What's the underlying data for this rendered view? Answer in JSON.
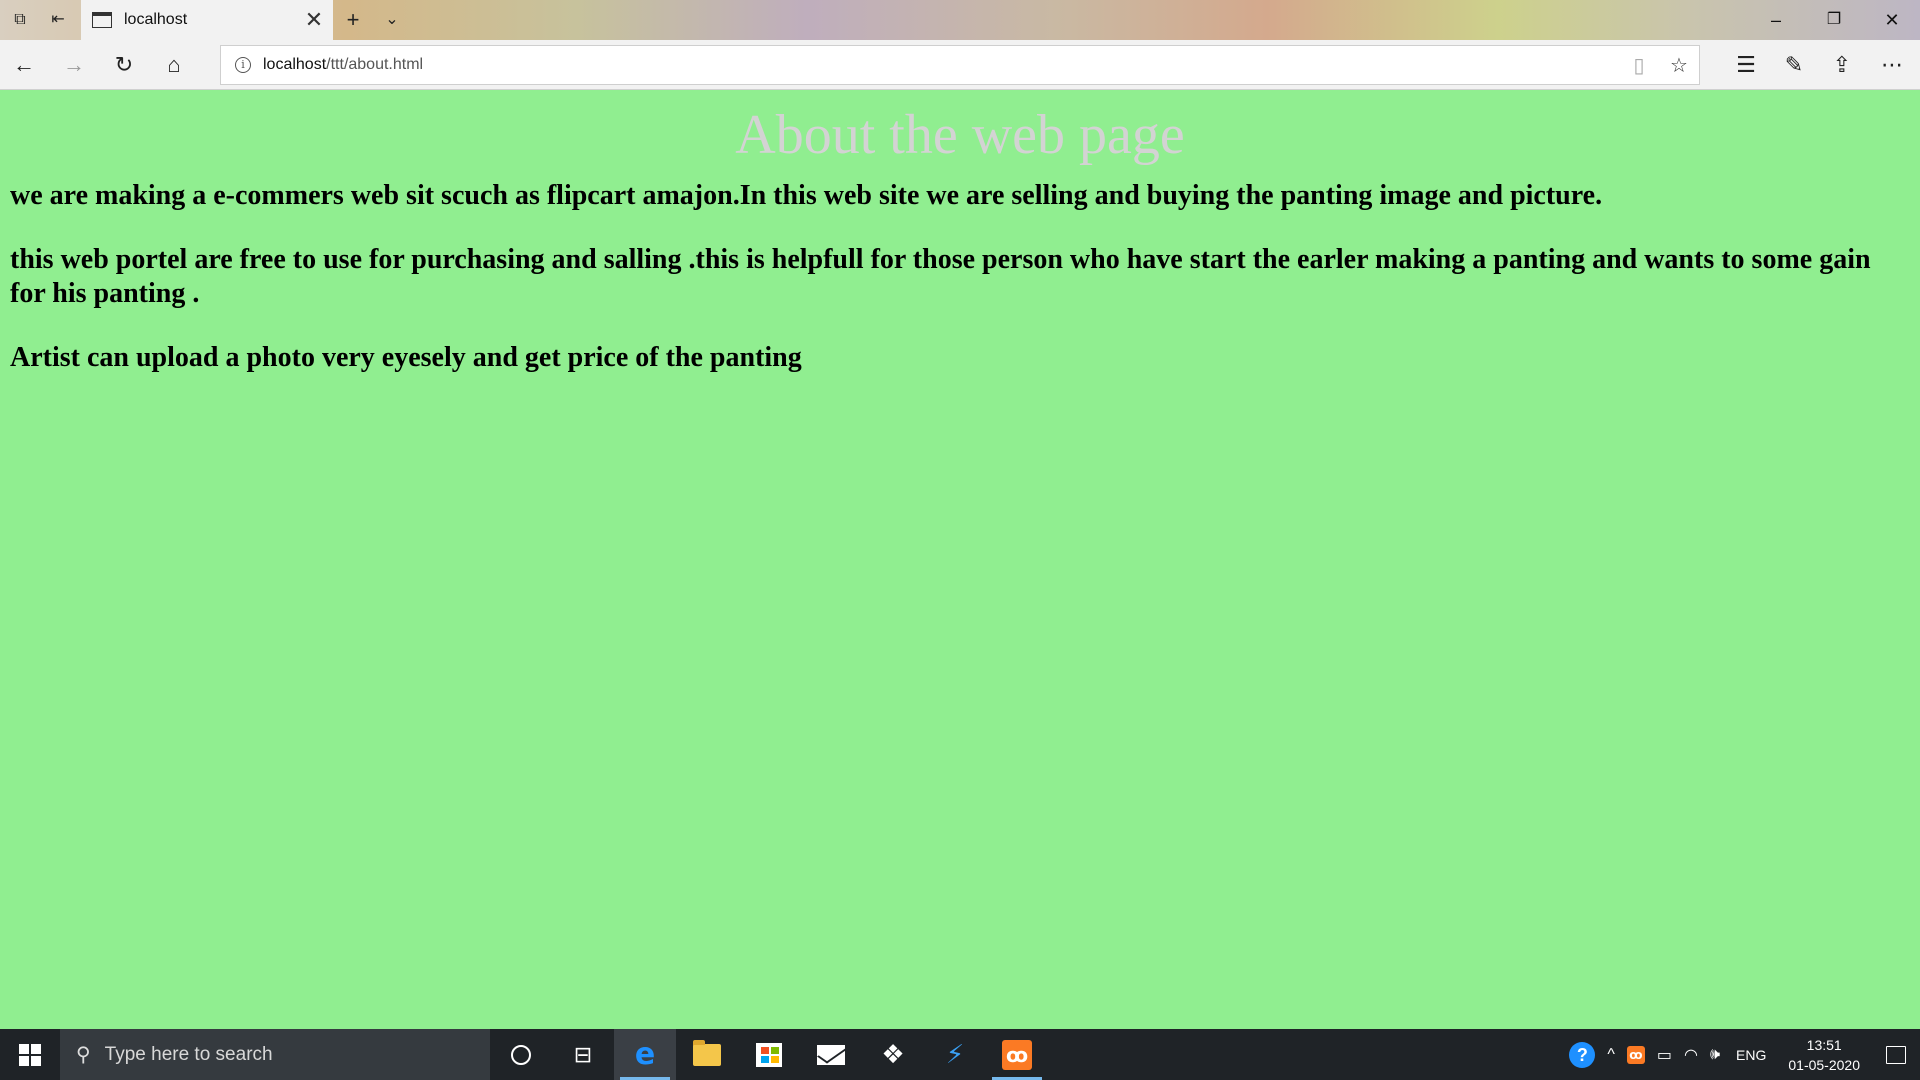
{
  "browser": {
    "tab": {
      "title": "localhost"
    },
    "address": {
      "host": "localhost",
      "path": "/ttt/about.html"
    }
  },
  "page": {
    "heading": "About the web page",
    "paragraphs": [
      "we are making a e-commers web sit scuch as flipcart amajon.In this web site we are selling and buying the panting image and picture.",
      "this web portel are free to use for purchasing and salling .this is helpfull for those person who have start the earler making a panting and wants to some gain for his panting .",
      "Artist can upload a photo very eyesely and get price of the panting"
    ],
    "background_color": "#90ee90",
    "heading_color": "#d3d3d3"
  },
  "taskbar": {
    "search_placeholder": "Type here to search",
    "language": "ENG",
    "time": "13:51",
    "date": "01-05-2020"
  }
}
